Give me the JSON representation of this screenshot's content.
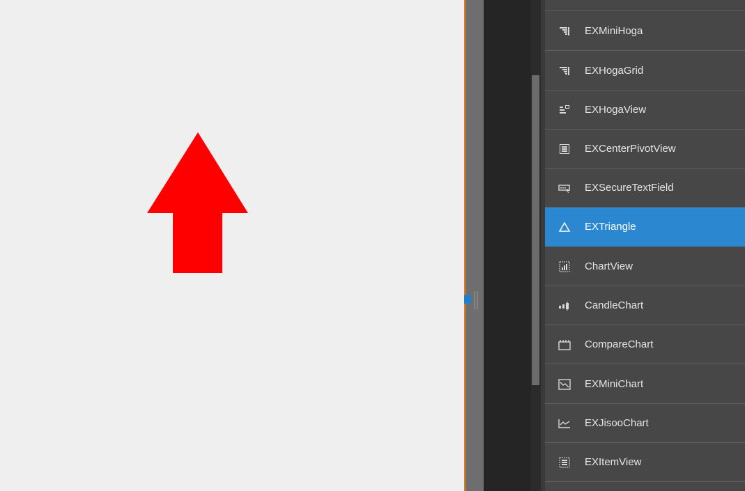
{
  "canvas": {
    "arrow_color": "#ff0000",
    "background": "#efefef"
  },
  "component_list": {
    "items": [
      {
        "label": "",
        "icon": "item-icon",
        "selected": false
      },
      {
        "label": "EXMiniHoga",
        "icon": "hoga-list-icon",
        "selected": false
      },
      {
        "label": "EXHogaGrid",
        "icon": "hoga-grid-icon",
        "selected": false
      },
      {
        "label": "EXHogaView",
        "icon": "hoga-view-icon",
        "selected": false
      },
      {
        "label": "EXCenterPivotView",
        "icon": "pivot-view-icon",
        "selected": false
      },
      {
        "label": "EXSecureTextField",
        "icon": "secure-text-field-icon",
        "selected": false
      },
      {
        "label": "EXTriangle",
        "icon": "triangle-icon",
        "selected": true
      },
      {
        "label": "ChartView",
        "icon": "chart-view-icon",
        "selected": false
      },
      {
        "label": "CandleChart",
        "icon": "candle-chart-icon",
        "selected": false
      },
      {
        "label": "CompareChart",
        "icon": "compare-chart-icon",
        "selected": false
      },
      {
        "label": "EXMiniChart",
        "icon": "mini-chart-icon",
        "selected": false
      },
      {
        "label": "EXJisooChart",
        "icon": "line-chart-icon",
        "selected": false
      },
      {
        "label": "EXItemView",
        "icon": "item-view-icon",
        "selected": false
      }
    ],
    "selected_color": "#2b87d0"
  }
}
